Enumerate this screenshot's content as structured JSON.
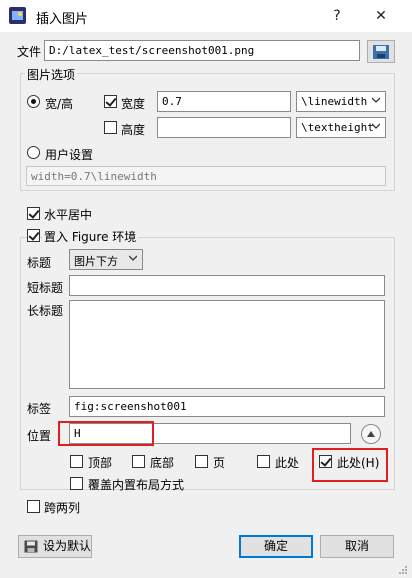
{
  "window": {
    "title": "插入图片",
    "help": "?",
    "close": "✕"
  },
  "file": {
    "label": "文件",
    "value": "D:/latex_test/screenshot001.png"
  },
  "options": {
    "legend": "图片选项",
    "width_height_label": "宽/高",
    "width_label": "宽度",
    "width_value": "0.7",
    "width_unit": "\\linewidth",
    "height_label": "高度",
    "height_value": "",
    "height_unit": "\\textheight",
    "user_setting_label": "用户设置",
    "user_setting_value": "width=0.7\\linewidth"
  },
  "center_label": "水平居中",
  "figure": {
    "legend": "置入 Figure 环境",
    "caption_label": "标题",
    "caption_position": "图片下方",
    "short_caption_label": "短标题",
    "short_caption_value": "",
    "long_caption_label": "长标题",
    "long_caption_value": "",
    "tag_label": "标签",
    "tag_value": "fig:screenshot001",
    "position_label": "位置",
    "position_value": "H",
    "placements": [
      "顶部",
      "底部",
      "页",
      "此处"
    ],
    "here_strict_label": "此处(H)",
    "override_label": "覆盖内置布局方式"
  },
  "span_two_label": "跨两列",
  "footer": {
    "default_label": "设为默认",
    "ok_label": "确定",
    "cancel_label": "取消"
  },
  "colors": {
    "highlight": "#e02020",
    "primary_border": "#0078d7"
  }
}
